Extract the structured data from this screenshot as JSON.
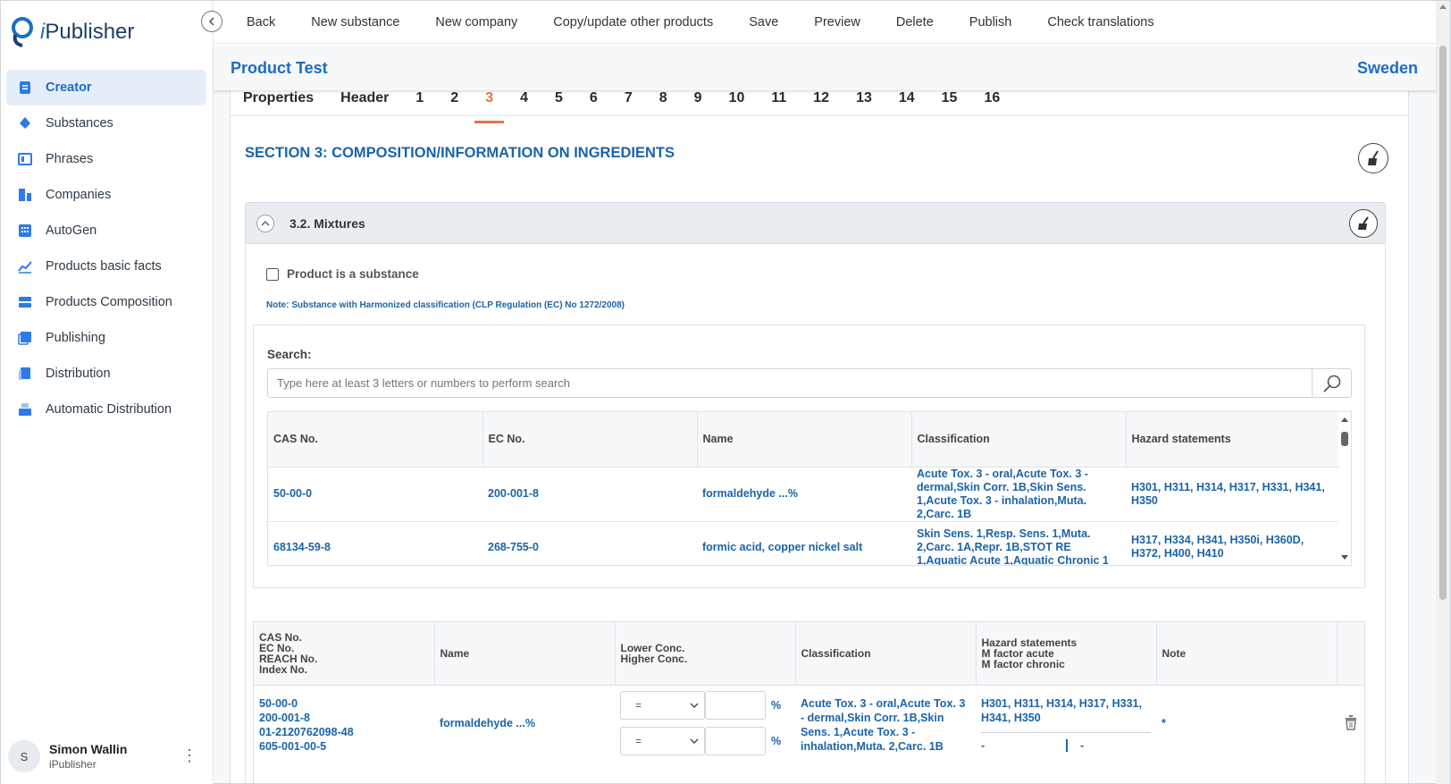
{
  "app": {
    "name_prefix": "i",
    "name_rest": "Publisher"
  },
  "sidebar": {
    "items": [
      {
        "label": "Creator",
        "icon": "creator-icon",
        "active": true
      },
      {
        "label": "Substances",
        "icon": "substances-icon"
      },
      {
        "label": "Phrases",
        "icon": "phrases-icon"
      },
      {
        "label": "Companies",
        "icon": "companies-icon"
      },
      {
        "label": "AutoGen",
        "icon": "autogen-icon"
      },
      {
        "label": "Products basic facts",
        "icon": "chart-icon"
      },
      {
        "label": "Products Composition",
        "icon": "composition-icon"
      },
      {
        "label": "Publishing",
        "icon": "publishing-icon"
      },
      {
        "label": "Distribution",
        "icon": "distribution-icon"
      },
      {
        "label": "Automatic Distribution",
        "icon": "auto-distribution-icon"
      }
    ],
    "user": {
      "initial": "S",
      "name": "Simon Wallin",
      "org": "iPublisher",
      "menu_glyph": "⋮"
    }
  },
  "toolbar": {
    "buttons": [
      "Back",
      "New substance",
      "New company",
      "Copy/update other products",
      "Save",
      "Preview",
      "Delete",
      "Publish",
      "Check translations"
    ]
  },
  "header": {
    "product": "Product Test",
    "country": "Sweden"
  },
  "tabs": [
    "Properties",
    "Header",
    "1",
    "2",
    "3",
    "4",
    "5",
    "6",
    "7",
    "8",
    "9",
    "10",
    "11",
    "12",
    "13",
    "14",
    "15",
    "16"
  ],
  "active_tab": "3",
  "section": {
    "title": "SECTION 3: COMPOSITION/INFORMATION ON INGREDIENTS",
    "subsection": "3.2. Mixtures",
    "checkbox_label": "Product is a substance",
    "note": "Note: Substance with Harmonized classification (CLP Regulation (EC) No 1272/2008)"
  },
  "search": {
    "label": "Search:",
    "placeholder": "Type here at least 3 letters or numbers to perform search",
    "columns": [
      "CAS No.",
      "EC No.",
      "Name",
      "Classification",
      "Hazard statements"
    ],
    "rows": [
      [
        "50-00-0",
        "200-001-8",
        "formaldehyde ...%",
        "Acute Tox. 3 - oral,Acute Tox. 3 - dermal,Skin Corr. 1B,Skin Sens. 1,Acute Tox. 3 - inhalation,Muta. 2,Carc. 1B",
        "H301, H311, H314, H317, H331, H341, H350"
      ],
      [
        "68134-59-8",
        "268-755-0",
        "formic acid, copper nickel salt",
        "Skin Sens. 1,Resp. Sens. 1,Muta. 2,Carc. 1A,Repr. 1B,STOT RE 1,Aquatic Acute 1,Aquatic Chronic 1",
        "H317, H334, H341, H350i, H360D, H372, H400, H410"
      ]
    ]
  },
  "composition": {
    "columns": {
      "ids": [
        "CAS No.",
        "EC No.",
        "REACH No.",
        "Index No."
      ],
      "name": "Name",
      "conc": [
        "Lower Conc.",
        "Higher Conc."
      ],
      "classification": "Classification",
      "hazard": [
        "Hazard statements",
        "M factor acute",
        "M factor chronic"
      ],
      "note": "Note"
    },
    "rows": [
      {
        "ids": [
          "50-00-0",
          "200-001-8",
          "01-2120762098-48",
          "605-001-00-5"
        ],
        "name": "formaldehyde ...%",
        "lower_op": "=",
        "higher_op": "=",
        "unit": "%",
        "classification": "Acute Tox. 3 - oral,Acute Tox. 3 - dermal,Skin Corr. 1B,Skin Sens. 1,Acute Tox. 3 - inhalation,Muta. 2,Carc. 1B",
        "hazard": "H301, H311, H314, H317, H331, H341, H350",
        "m_acute": "-",
        "m_chronic": "-",
        "note": "*"
      }
    ]
  }
}
